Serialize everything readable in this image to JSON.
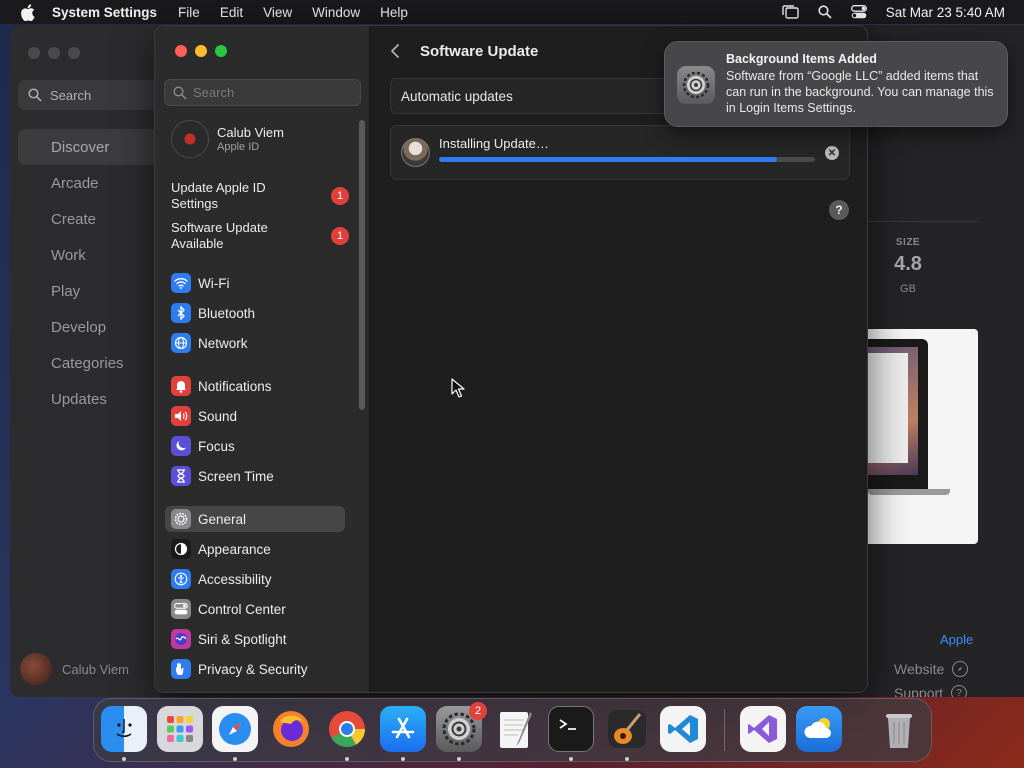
{
  "menubar": {
    "app_name": "System Settings",
    "menus": [
      "File",
      "Edit",
      "View",
      "Window",
      "Help"
    ],
    "clock": "Sat Mar 23  5:40 AM"
  },
  "appstore": {
    "search_placeholder": "Search",
    "nav": [
      "Discover",
      "Arcade",
      "Create",
      "Work",
      "Play",
      "Develop",
      "Categories",
      "Updates"
    ],
    "active_nav": "Discover",
    "user_name": "Calub Viem",
    "size_label": "SIZE",
    "size_value": "4.8",
    "size_unit": "GB",
    "developer_link": "Apple",
    "links": [
      "Website",
      "Support"
    ]
  },
  "settings": {
    "search_placeholder": "Search",
    "account": {
      "name": "Calub Viem",
      "subtitle": "Apple ID"
    },
    "alerts": [
      {
        "label_line1": "Update Apple ID",
        "label_line2": "Settings",
        "badge": "1"
      },
      {
        "label_line1": "Software Update",
        "label_line2": "Available",
        "badge": "1"
      }
    ],
    "items": [
      {
        "label": "Wi-Fi",
        "icon": "wifi-icon",
        "color": "#2f7bf0"
      },
      {
        "label": "Bluetooth",
        "icon": "bluetooth-icon",
        "color": "#2f7bf0"
      },
      {
        "label": "Network",
        "icon": "globe-icon",
        "color": "#2f7bf0"
      },
      {
        "label": "Notifications",
        "icon": "bell-icon",
        "color": "#e0413a"
      },
      {
        "label": "Sound",
        "icon": "speaker-icon",
        "color": "#e0413a"
      },
      {
        "label": "Focus",
        "icon": "moon-icon",
        "color": "#5a4fd6"
      },
      {
        "label": "Screen Time",
        "icon": "hourglass-icon",
        "color": "#5a4fd6"
      },
      {
        "label": "General",
        "icon": "gear-icon",
        "color": "#8a8a8c"
      },
      {
        "label": "Appearance",
        "icon": "appearance-icon",
        "color": "#1a1a1a"
      },
      {
        "label": "Accessibility",
        "icon": "accessibility-icon",
        "color": "#2f7bf0"
      },
      {
        "label": "Control Center",
        "icon": "control-center-icon",
        "color": "#8a8a8c"
      },
      {
        "label": "Siri & Spotlight",
        "icon": "siri-icon",
        "color": "#c03aa0"
      },
      {
        "label": "Privacy & Security",
        "icon": "hand-icon",
        "color": "#2f7bf0"
      }
    ],
    "active_item": "General",
    "page_title": "Software Update",
    "automatic_updates_label": "Automatic updates",
    "install_label": "Installing Update…",
    "progress": 0.9,
    "help_label": "?"
  },
  "notification": {
    "title": "Background Items Added",
    "body": "Software from “Google LLC” added items that can run in the background. You can manage this in Login Items Settings."
  },
  "dock": {
    "apps": [
      "Finder",
      "Launchpad",
      "Safari",
      "Firefox",
      "Chrome",
      "App Store",
      "System Settings",
      "TextEdit",
      "Terminal",
      "GarageBand",
      "Visual Studio Code",
      "Visual Studio",
      "Weather",
      "Trash"
    ],
    "settings_badge": "2"
  }
}
